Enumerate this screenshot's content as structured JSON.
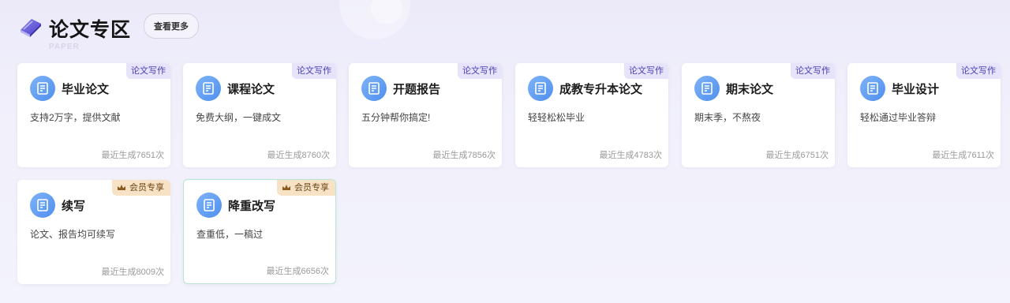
{
  "header": {
    "title": "论文专区",
    "subtitle": "PAPER",
    "more_label": "查看更多"
  },
  "colors": {
    "accent": "#4f8fee",
    "tag_text": "#4a3fb8",
    "tag_bg": "#e6e3fb",
    "vip_bg": "#f8e2c6",
    "vip_text": "#6a4312"
  },
  "cards": [
    {
      "title": "毕业论文",
      "desc": "支持2万字，提供文献",
      "tag": "论文写作",
      "tag_type": "normal",
      "count": "最近生成7651次"
    },
    {
      "title": "课程论文",
      "desc": "免费大纲，一键成文",
      "tag": "论文写作",
      "tag_type": "normal",
      "count": "最近生成8760次"
    },
    {
      "title": "开题报告",
      "desc": "五分钟帮你搞定!",
      "tag": "论文写作",
      "tag_type": "normal",
      "count": "最近生成7856次"
    },
    {
      "title": "成教专升本论文",
      "desc": "轻轻松松毕业",
      "tag": "论文写作",
      "tag_type": "normal",
      "count": "最近生成4783次"
    },
    {
      "title": "期末论文",
      "desc": "期末季，不熬夜",
      "tag": "论文写作",
      "tag_type": "normal",
      "count": "最近生成6751次"
    },
    {
      "title": "毕业设计",
      "desc": "轻松通过毕业答辩",
      "tag": "论文写作",
      "tag_type": "normal",
      "count": "最近生成7611次"
    },
    {
      "title": "续写",
      "desc": "论文、报告均可续写",
      "tag": "会员专享",
      "tag_type": "vip",
      "count": "最近生成8009次"
    },
    {
      "title": "降重改写",
      "desc": "查重低，一稿过",
      "tag": "会员专享",
      "tag_type": "vip",
      "count": "最近生成6656次"
    }
  ]
}
